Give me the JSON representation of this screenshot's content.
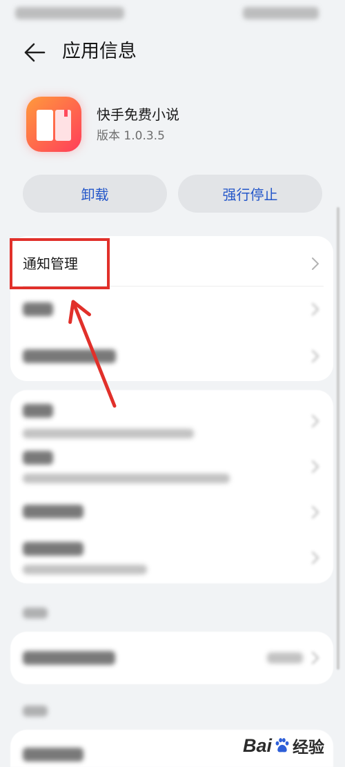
{
  "header": {
    "title": "应用信息",
    "back_icon": "arrow-left-icon"
  },
  "app": {
    "name": "快手免费小说",
    "version": "版本 1.0.3.5",
    "icon": "book-app-icon"
  },
  "actions": {
    "uninstall_label": "卸载",
    "force_stop_label": "强行停止"
  },
  "settings": {
    "notification_management_label": "通知管理",
    "row_chevron_icon": "chevron-right-icon"
  },
  "annotation": {
    "highlight_box_color": "#e1302a",
    "arrow_color": "#e1302a"
  },
  "watermark": {
    "logo_left": "Bai",
    "logo_right": "经验",
    "logo_icon": "paw-icon"
  },
  "colors": {
    "background": "#f1f3f5",
    "card": "#ffffff",
    "button_background": "#e2e4e7",
    "accent_text": "#2356c9"
  }
}
